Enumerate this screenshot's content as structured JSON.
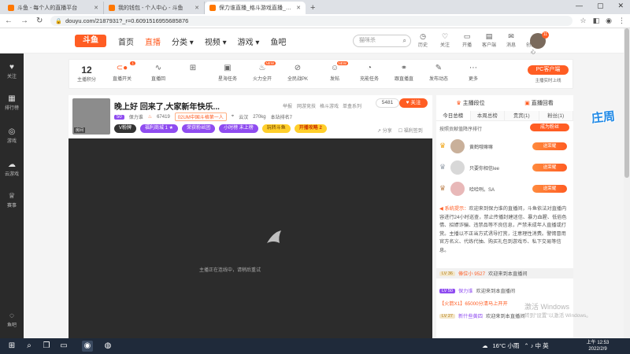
{
  "browser": {
    "tabs": [
      {
        "title": "斗鱼 - 每个人的直播平台",
        "active": false
      },
      {
        "title": "我的钱包 - 个人中心 - 斗鱼",
        "active": false
      },
      {
        "title": "保力谁直播_格斗游戏直播_斗鱼直播",
        "active": true
      }
    ],
    "url": "douyu.com/2187931?_r=0.6091516955685876",
    "new_tab": "+",
    "back": "←",
    "forward": "→",
    "reload": "↻",
    "window_buttons": [
      "—",
      "▢",
      "✕"
    ]
  },
  "header": {
    "logo": "斗鱼",
    "nav": [
      "首页",
      "直播",
      "分类 ▾",
      "视频 ▾",
      "游戏 ▾",
      "鱼吧"
    ],
    "search_placeholder": "猫咪杀",
    "icons": [
      {
        "label": "历史",
        "icon": "history-icon"
      },
      {
        "label": "关注",
        "icon": "follow-icon"
      },
      {
        "label": "开播",
        "icon": "broadcast-icon"
      },
      {
        "label": "客户端",
        "icon": "client-icon"
      },
      {
        "label": "消息",
        "icon": "message-icon"
      },
      {
        "label": "创作中心",
        "icon": "creator-icon"
      }
    ],
    "avatar_badge": "11"
  },
  "left_sidebar": [
    {
      "label": "关注",
      "icon": "heart-icon"
    },
    {
      "label": "排行榜",
      "icon": "rank-icon"
    },
    {
      "label": "游戏",
      "icon": "gamepad-icon"
    },
    {
      "label": "云游戏",
      "icon": "cloud-game-icon"
    },
    {
      "label": "赛事",
      "icon": "trophy-icon"
    },
    {
      "label": "鱼吧",
      "icon": "fishbar-icon"
    }
  ],
  "funcbar": {
    "level_number": "12",
    "level_label": "主播积分",
    "items": [
      {
        "label": "直播开关",
        "icon": "toggle-icon",
        "badge": "1"
      },
      {
        "label": "直播回",
        "icon": "wave-icon",
        "badge": ""
      },
      {
        "label": "",
        "icon": "gift-icon",
        "badge": ""
      },
      {
        "label": "星海任务",
        "icon": "ad-icon",
        "badge": ""
      },
      {
        "label": "火力全开",
        "icon": "fire-icon",
        "badge": "NEW"
      },
      {
        "label": "全民战PK",
        "icon": "pk-icon",
        "badge": ""
      },
      {
        "label": "发帖",
        "icon": "post-icon",
        "badge": "NEW"
      },
      {
        "label": "充能任务",
        "icon": "gauge-icon",
        "badge": ""
      },
      {
        "label": "跟直播直",
        "icon": "link-icon",
        "badge": ""
      },
      {
        "label": "发布动态",
        "icon": "edit-icon",
        "badge": ""
      },
      {
        "label": "更多",
        "icon": "more-icon",
        "badge": ""
      }
    ],
    "pc_button": "PC客户端",
    "pc_sub": "主播实时上线"
  },
  "stream": {
    "title": "晚上好 回来了,大家新年快乐...",
    "anchor_label": "房间",
    "anchor_status": "关注",
    "report": "举报",
    "tags": [
      "网游竞技",
      "格斗游戏",
      "单盒系列"
    ],
    "hot_count": "5481",
    "follow_label": "关注",
    "level": "50",
    "anchor_name": "保力谁",
    "fans": "67419",
    "honor": "02UM中国斗格第一人",
    "location": "云汉",
    "weight": "270kg",
    "subscribe": "本站排名7",
    "pills": [
      {
        "text": "V粉牌",
        "style": "dark"
      },
      {
        "text": "福利商城 1 ★",
        "style": "purple"
      },
      {
        "text": "荣获粉丝团",
        "style": "purple"
      },
      {
        "text": "小时榜 未上榜",
        "style": "purple"
      },
      {
        "text": "玩转斗鱼",
        "style": "yellow"
      },
      {
        "text": "开播攻略 2",
        "style": "orange"
      }
    ],
    "share": "分享",
    "gift_record": "福利签到"
  },
  "player": {
    "status_text": "主播正在连线中，请稍后重试"
  },
  "right_panel": {
    "tabs1": [
      "主播段位",
      "直播回看"
    ],
    "tabs2": [
      "今日总榜",
      "本周总榜",
      "贵宾(1)",
      "粉丝(1)"
    ],
    "rank_hint": "按照贡献值降序排行",
    "rank_button": "成为粉丝",
    "ranks": [
      {
        "crown": "♛",
        "crown_color": "#f0a619",
        "name": "黄鹤哦嘛嘛",
        "button": "送荣耀"
      },
      {
        "crown": "♛",
        "crown_color": "#9aa3ae",
        "name": "只要你相信lee",
        "button": "送荣耀"
      },
      {
        "crown": "♛",
        "crown_color": "#c08858",
        "name": "哈哈咧。SA",
        "button": "送荣耀"
      }
    ],
    "system_label": "系统提示：",
    "system_text": "欢迎来到保力谁的直播间，斗鱼依法对直播内容进行24小时巡查，禁止传播封建迷信、暴力血腥、低俗色情、招嫖诈骗、违禁品等不良信息，严禁未成年人直播或打赏。主播以不正当方式诱导打赏，注意理性消费。警惕冒用官方名义、代练代抽、购买礼包到游戏币、私下交易等信息。",
    "welcomes": [
      {
        "level": "LV 36",
        "name": "俸位小 9527",
        "text": "欢迎来到本直播间",
        "highlight": true
      },
      {
        "level": "LV 50",
        "name": "保力谁",
        "text": "欢迎来到本直播间",
        "highlight": false
      },
      {
        "level": "",
        "name": "【火箭X1】65000分清马上开开",
        "text": "",
        "highlight": false
      },
      {
        "level": "LV 27",
        "name": "新什些黄四",
        "text": "欢迎来到本直播间",
        "highlight": false
      }
    ]
  },
  "ad": {
    "text": "庄周"
  },
  "watermark": {
    "line1": "激活 Windows",
    "line2": "转到\"设置\"以激活 Windows。"
  },
  "taskbar": {
    "weather": "16°C 小雨",
    "tray": "⌃ ♪ 中 英",
    "time": "上午 12:53",
    "date": "2022/2/9"
  },
  "colors": {
    "accent": "#ff5d23",
    "purple": "#8f4cf0",
    "player_bg": "#2c2c2c",
    "sidebar_bg": "#2a2a2a",
    "taskbar_bg": "#1f2a3a"
  }
}
